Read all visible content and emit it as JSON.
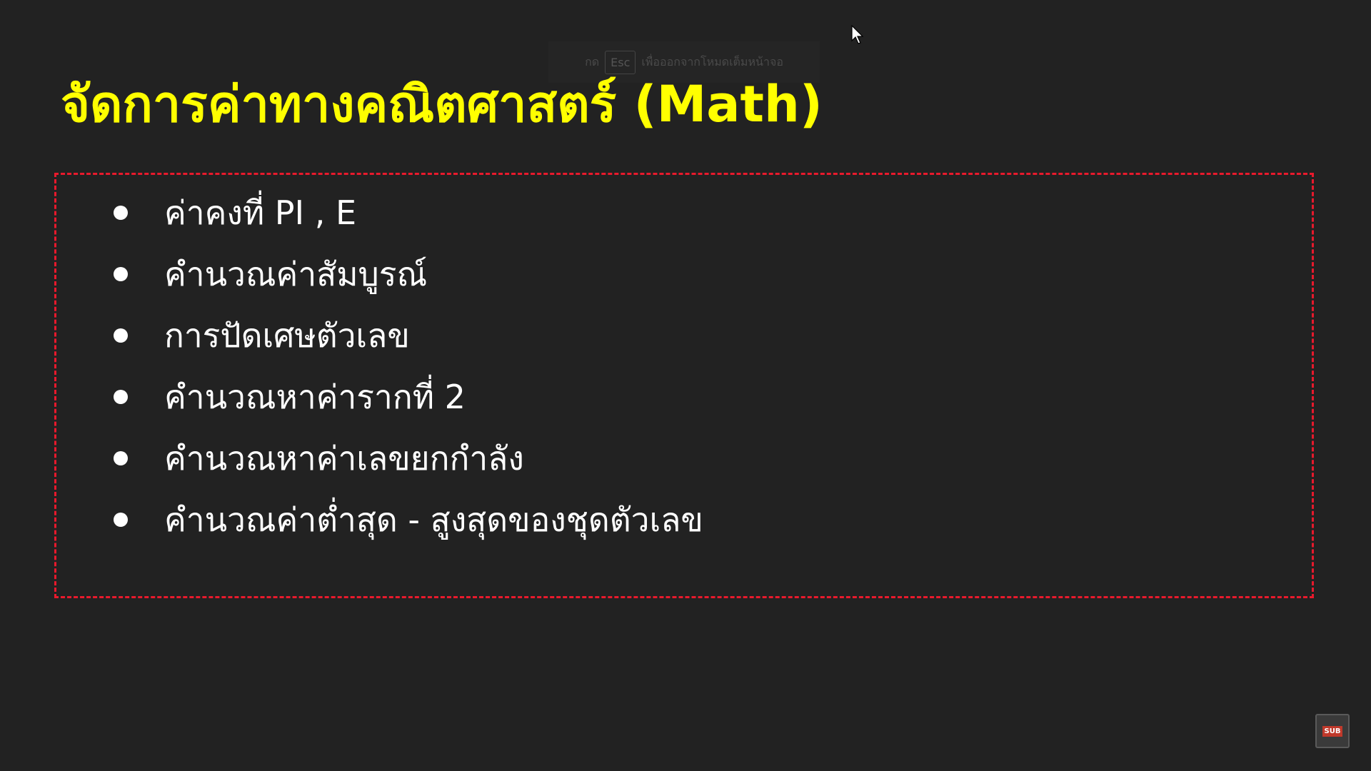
{
  "fullscreen_hint": {
    "before": "กด",
    "key": "Esc",
    "after": "เพื่อออกจากโหมดเต็มหน้าจอ"
  },
  "slide": {
    "title": "จัดการค่าทางคณิตศาสตร์ (Math)",
    "bullets": [
      "ค่าคงที่ PI , E",
      "คำนวณค่าสัมบูรณ์",
      "การปัดเศษตัวเลข",
      "คำนวณหาค่ารากที่ 2",
      "คำนวณหาค่าเลขยกกำลัง",
      "คำนวณค่าต่ำสุด - สูงสุดของชุดตัวเลข"
    ]
  },
  "overlay": {
    "sub_icon_label": "SUB"
  },
  "colors": {
    "background": "#222222",
    "title": "#ffff00",
    "box_border": "#e8192c",
    "bullet_text": "#ffffff"
  }
}
